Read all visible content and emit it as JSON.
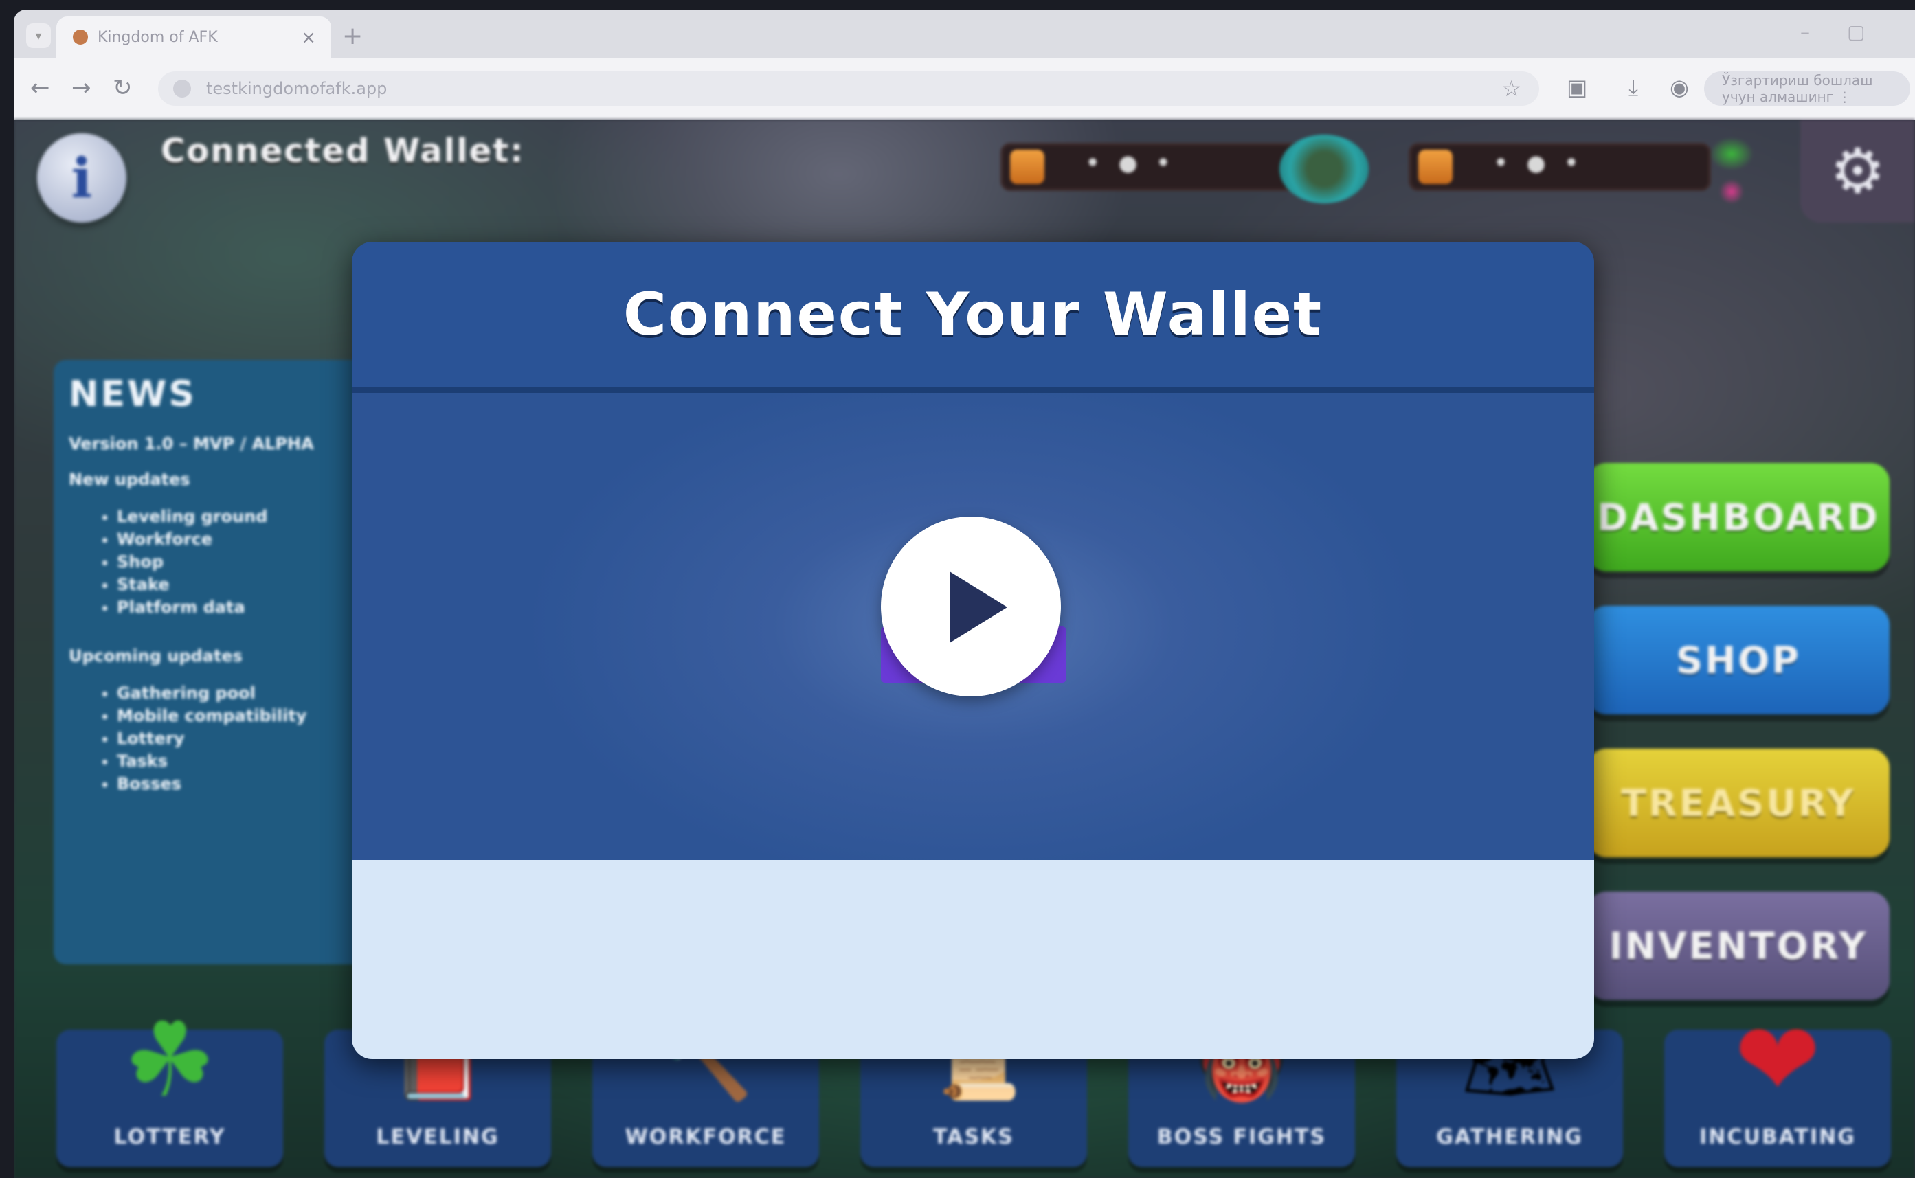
{
  "browser": {
    "tab_title": "Kingdom of AFK",
    "tab_close": "×",
    "new_tab": "+",
    "url": "testkingdomofafk.app",
    "profile_label": "Ўзгартириш бошлаш учун алмашинг ⋮"
  },
  "hud": {
    "info_glyph": "i",
    "wallet_label": "Connected Wallet:",
    "resource1_value": "• ● •",
    "resource2_value": "• ● •",
    "settings_glyph": "⚙"
  },
  "news": {
    "title": "NEWS",
    "version": "Version 1.0 – MVP / ALPHA",
    "new_updates_heading": "New updates",
    "new_updates": [
      "Leveling ground",
      "Workforce",
      "Shop",
      "Stake",
      "Platform data"
    ],
    "upcoming_heading": "Upcoming updates",
    "upcoming": [
      "Gathering pool",
      "Mobile compatibility",
      "Lottery",
      "Tasks",
      "Bosses"
    ]
  },
  "menu": {
    "dashboard": "DASHBOARD",
    "shop": "SHOP",
    "treasury": "TREASURY",
    "inventory": "INVENTORY"
  },
  "bottom_nav": [
    {
      "label": "LOTTERY",
      "icon": "☘"
    },
    {
      "label": "LEVELING",
      "icon": "📕"
    },
    {
      "label": "WORKFORCE",
      "icon": "🔨"
    },
    {
      "label": "TASKS",
      "icon": "📜"
    },
    {
      "label": "BOSS FIGHTS",
      "icon": "👹"
    },
    {
      "label": "GATHERING",
      "icon": "🗺"
    },
    {
      "label": "INCUBATING",
      "icon": "❤"
    }
  ],
  "modal": {
    "title": "Connect Your Wallet"
  },
  "colors": {
    "modal_header": "#2a5396",
    "modal_footer": "#d7e7f8",
    "dashboard": "#4fbf28",
    "shop": "#2476c8",
    "treasury": "#d6b82a",
    "inventory": "#645c88"
  }
}
